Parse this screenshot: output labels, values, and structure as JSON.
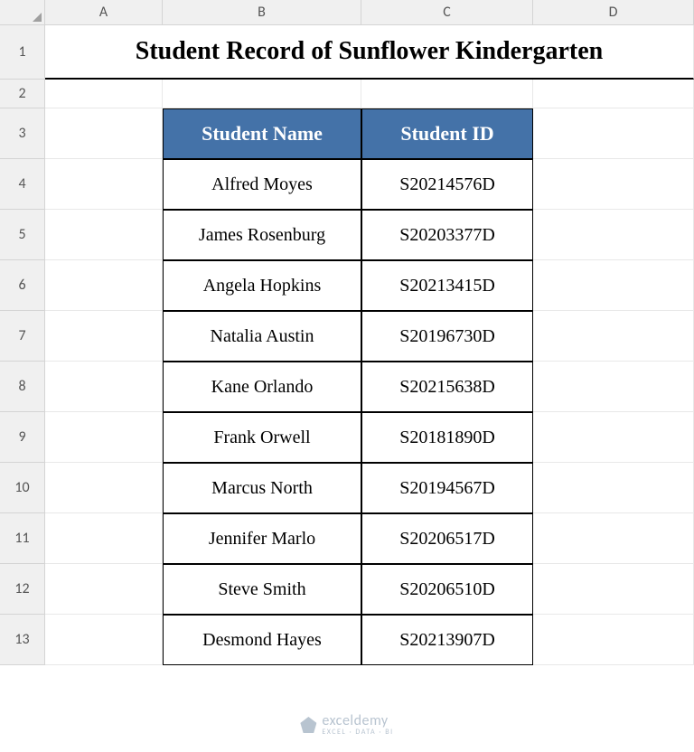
{
  "columns": [
    "A",
    "B",
    "C",
    "D"
  ],
  "rows": [
    "1",
    "2",
    "3",
    "4",
    "5",
    "6",
    "7",
    "8",
    "9",
    "10",
    "11",
    "12",
    "13"
  ],
  "title": "Student Record of Sunflower Kindergarten",
  "table": {
    "headers": {
      "name": "Student Name",
      "id": "Student ID"
    },
    "data": [
      {
        "name": "Alfred Moyes",
        "id": "S20214576D"
      },
      {
        "name": "James Rosenburg",
        "id": "S20203377D"
      },
      {
        "name": "Angela Hopkins",
        "id": "S20213415D"
      },
      {
        "name": "Natalia Austin",
        "id": "S20196730D"
      },
      {
        "name": "Kane Orlando",
        "id": "S20215638D"
      },
      {
        "name": "Frank Orwell",
        "id": "S20181890D"
      },
      {
        "name": "Marcus North",
        "id": "S20194567D"
      },
      {
        "name": "Jennifer Marlo",
        "id": "S20206517D"
      },
      {
        "name": "Steve Smith",
        "id": "S20206510D"
      },
      {
        "name": "Desmond Hayes",
        "id": "S20213907D"
      }
    ]
  },
  "watermark": {
    "main": "exceldemy",
    "sub": "EXCEL · DATA · BI"
  }
}
